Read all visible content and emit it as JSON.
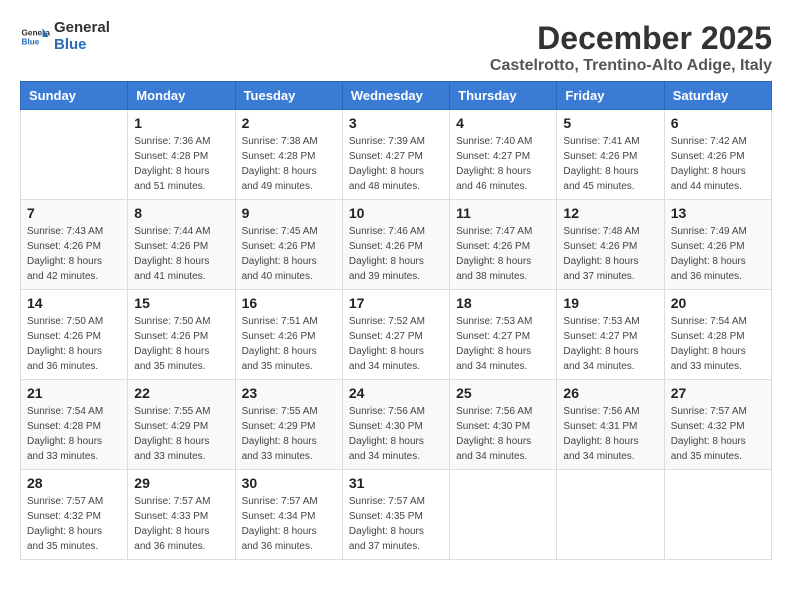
{
  "header": {
    "logo_general": "General",
    "logo_blue": "Blue",
    "month_year": "December 2025",
    "location": "Castelrotto, Trentino-Alto Adige, Italy"
  },
  "days_of_week": [
    "Sunday",
    "Monday",
    "Tuesday",
    "Wednesday",
    "Thursday",
    "Friday",
    "Saturday"
  ],
  "weeks": [
    [
      {
        "day": "",
        "info": ""
      },
      {
        "day": "1",
        "info": "Sunrise: 7:36 AM\nSunset: 4:28 PM\nDaylight: 8 hours\nand 51 minutes."
      },
      {
        "day": "2",
        "info": "Sunrise: 7:38 AM\nSunset: 4:28 PM\nDaylight: 8 hours\nand 49 minutes."
      },
      {
        "day": "3",
        "info": "Sunrise: 7:39 AM\nSunset: 4:27 PM\nDaylight: 8 hours\nand 48 minutes."
      },
      {
        "day": "4",
        "info": "Sunrise: 7:40 AM\nSunset: 4:27 PM\nDaylight: 8 hours\nand 46 minutes."
      },
      {
        "day": "5",
        "info": "Sunrise: 7:41 AM\nSunset: 4:26 PM\nDaylight: 8 hours\nand 45 minutes."
      },
      {
        "day": "6",
        "info": "Sunrise: 7:42 AM\nSunset: 4:26 PM\nDaylight: 8 hours\nand 44 minutes."
      }
    ],
    [
      {
        "day": "7",
        "info": "Sunrise: 7:43 AM\nSunset: 4:26 PM\nDaylight: 8 hours\nand 42 minutes."
      },
      {
        "day": "8",
        "info": "Sunrise: 7:44 AM\nSunset: 4:26 PM\nDaylight: 8 hours\nand 41 minutes."
      },
      {
        "day": "9",
        "info": "Sunrise: 7:45 AM\nSunset: 4:26 PM\nDaylight: 8 hours\nand 40 minutes."
      },
      {
        "day": "10",
        "info": "Sunrise: 7:46 AM\nSunset: 4:26 PM\nDaylight: 8 hours\nand 39 minutes."
      },
      {
        "day": "11",
        "info": "Sunrise: 7:47 AM\nSunset: 4:26 PM\nDaylight: 8 hours\nand 38 minutes."
      },
      {
        "day": "12",
        "info": "Sunrise: 7:48 AM\nSunset: 4:26 PM\nDaylight: 8 hours\nand 37 minutes."
      },
      {
        "day": "13",
        "info": "Sunrise: 7:49 AM\nSunset: 4:26 PM\nDaylight: 8 hours\nand 36 minutes."
      }
    ],
    [
      {
        "day": "14",
        "info": "Sunrise: 7:50 AM\nSunset: 4:26 PM\nDaylight: 8 hours\nand 36 minutes."
      },
      {
        "day": "15",
        "info": "Sunrise: 7:50 AM\nSunset: 4:26 PM\nDaylight: 8 hours\nand 35 minutes."
      },
      {
        "day": "16",
        "info": "Sunrise: 7:51 AM\nSunset: 4:26 PM\nDaylight: 8 hours\nand 35 minutes."
      },
      {
        "day": "17",
        "info": "Sunrise: 7:52 AM\nSunset: 4:27 PM\nDaylight: 8 hours\nand 34 minutes."
      },
      {
        "day": "18",
        "info": "Sunrise: 7:53 AM\nSunset: 4:27 PM\nDaylight: 8 hours\nand 34 minutes."
      },
      {
        "day": "19",
        "info": "Sunrise: 7:53 AM\nSunset: 4:27 PM\nDaylight: 8 hours\nand 34 minutes."
      },
      {
        "day": "20",
        "info": "Sunrise: 7:54 AM\nSunset: 4:28 PM\nDaylight: 8 hours\nand 33 minutes."
      }
    ],
    [
      {
        "day": "21",
        "info": "Sunrise: 7:54 AM\nSunset: 4:28 PM\nDaylight: 8 hours\nand 33 minutes."
      },
      {
        "day": "22",
        "info": "Sunrise: 7:55 AM\nSunset: 4:29 PM\nDaylight: 8 hours\nand 33 minutes."
      },
      {
        "day": "23",
        "info": "Sunrise: 7:55 AM\nSunset: 4:29 PM\nDaylight: 8 hours\nand 33 minutes."
      },
      {
        "day": "24",
        "info": "Sunrise: 7:56 AM\nSunset: 4:30 PM\nDaylight: 8 hours\nand 34 minutes."
      },
      {
        "day": "25",
        "info": "Sunrise: 7:56 AM\nSunset: 4:30 PM\nDaylight: 8 hours\nand 34 minutes."
      },
      {
        "day": "26",
        "info": "Sunrise: 7:56 AM\nSunset: 4:31 PM\nDaylight: 8 hours\nand 34 minutes."
      },
      {
        "day": "27",
        "info": "Sunrise: 7:57 AM\nSunset: 4:32 PM\nDaylight: 8 hours\nand 35 minutes."
      }
    ],
    [
      {
        "day": "28",
        "info": "Sunrise: 7:57 AM\nSunset: 4:32 PM\nDaylight: 8 hours\nand 35 minutes."
      },
      {
        "day": "29",
        "info": "Sunrise: 7:57 AM\nSunset: 4:33 PM\nDaylight: 8 hours\nand 36 minutes."
      },
      {
        "day": "30",
        "info": "Sunrise: 7:57 AM\nSunset: 4:34 PM\nDaylight: 8 hours\nand 36 minutes."
      },
      {
        "day": "31",
        "info": "Sunrise: 7:57 AM\nSunset: 4:35 PM\nDaylight: 8 hours\nand 37 minutes."
      },
      {
        "day": "",
        "info": ""
      },
      {
        "day": "",
        "info": ""
      },
      {
        "day": "",
        "info": ""
      }
    ]
  ]
}
